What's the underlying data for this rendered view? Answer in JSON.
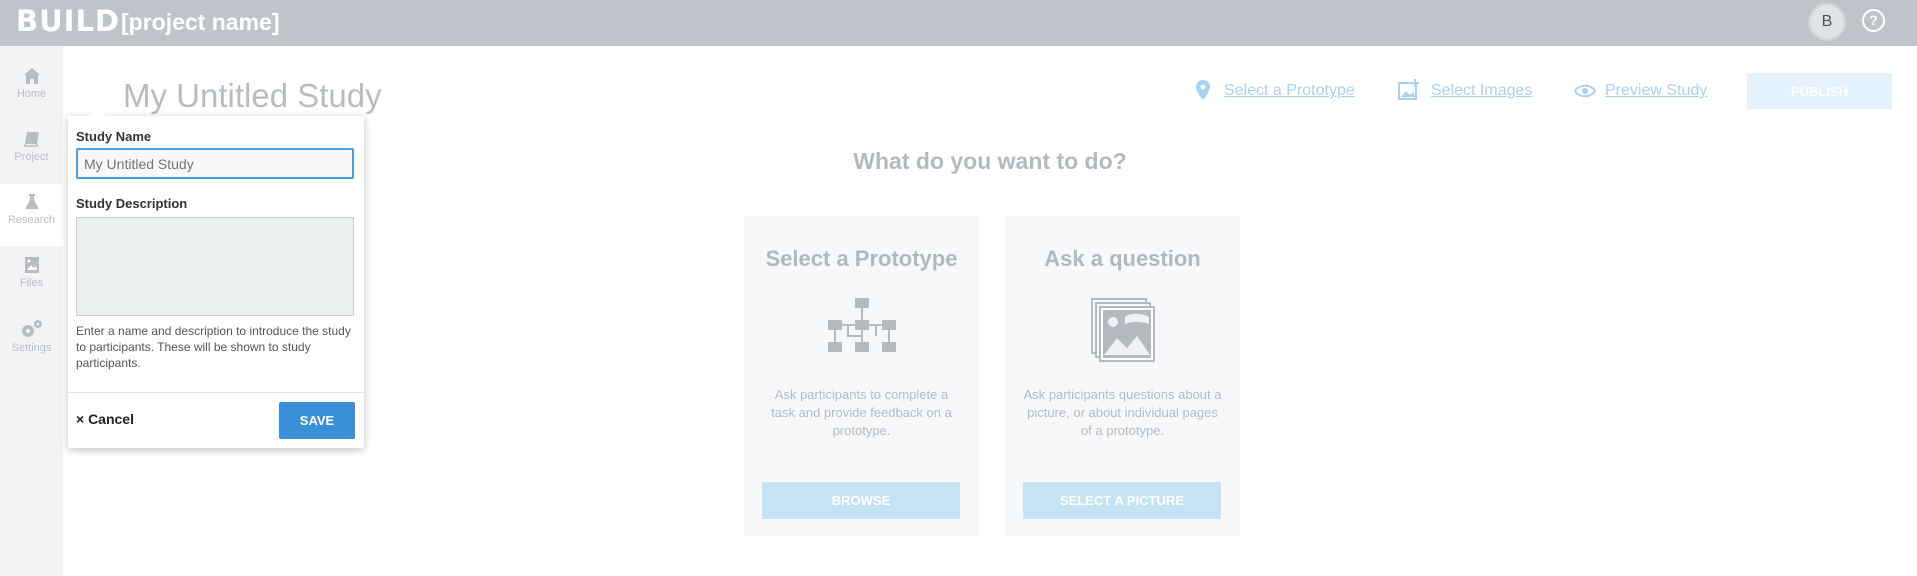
{
  "app": {
    "logo": "BUILD",
    "project_name": "[project name]",
    "avatar_initial": "B",
    "help": "?"
  },
  "sidebar": {
    "items": [
      {
        "label": "Home",
        "icon": "home-icon"
      },
      {
        "label": "Project",
        "icon": "book-icon"
      },
      {
        "label": "Research",
        "icon": "flask-icon",
        "active": true
      },
      {
        "label": "Files",
        "icon": "image-file-icon"
      },
      {
        "label": "Settings",
        "icon": "gears-icon"
      }
    ]
  },
  "header": {
    "title": "My Untitled Study",
    "links": [
      {
        "label": "Select a Prototype",
        "icon": "map-pin-icon"
      },
      {
        "label": "Select Images",
        "icon": "add-image-icon"
      },
      {
        "label": "Preview Study",
        "icon": "eye-icon"
      }
    ],
    "publish_label": "PUBLISH"
  },
  "main": {
    "question": "What do you want to do?",
    "cards": [
      {
        "title": "Select a Prototype",
        "icon": "sitemap-icon",
        "description": "Ask participants to complete a task and provide feedback on a prototype.",
        "button": "BROWSE"
      },
      {
        "title": "Ask a question",
        "icon": "picture-stack-icon",
        "description": "Ask participants questions about a picture, or about individual pages of a prototype.",
        "button": "SELECT A PICTURE"
      }
    ]
  },
  "popover": {
    "name_label": "Study Name",
    "name_placeholder": "My Untitled Study",
    "description_label": "Study Description",
    "help_text": "Enter a name and description to introduce the study to participants. These will be shown to study participants.",
    "cancel_label": "× Cancel",
    "save_label": "SAVE"
  },
  "colors": {
    "topbar": "#bfc4cb",
    "accent": "#3a8fd9",
    "link": "#a9d2f2"
  }
}
